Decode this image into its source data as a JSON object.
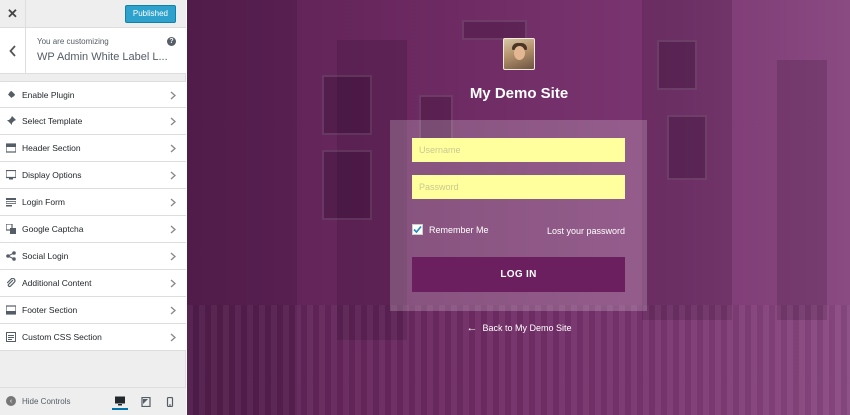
{
  "topbar": {
    "close_glyph": "✕",
    "publish_label": "Published"
  },
  "info": {
    "label": "You are customizing",
    "title": "WP Admin White Label L...",
    "help_glyph": "?"
  },
  "menu": {
    "items": [
      {
        "label": "Enable Plugin",
        "icon": "plugin-icon"
      },
      {
        "label": "Select Template",
        "icon": "pin-icon"
      },
      {
        "label": "Header Section",
        "icon": "header-icon"
      },
      {
        "label": "Display Options",
        "icon": "monitor-icon"
      },
      {
        "label": "Login Form",
        "icon": "form-icon"
      },
      {
        "label": "Google Captcha",
        "icon": "captcha-icon"
      },
      {
        "label": "Social Login",
        "icon": "share-icon"
      },
      {
        "label": "Additional Content",
        "icon": "paperclip-icon"
      },
      {
        "label": "Footer Section",
        "icon": "footer-icon"
      },
      {
        "label": "Custom CSS Section",
        "icon": "css-icon"
      }
    ]
  },
  "bottombar": {
    "hide_label": "Hide Controls",
    "devices": [
      "desktop-icon",
      "tablet-icon",
      "mobile-icon"
    ],
    "active_device": "desktop-icon"
  },
  "preview": {
    "site_title": "My Demo Site",
    "username_placeholder": "Username",
    "password_placeholder": "Password",
    "remember_label": "Remember Me",
    "remember_checked": true,
    "lost_password": "Lost your password",
    "login_button": "LOG IN",
    "back_arrow": "←",
    "back_link": "Back to My Demo Site"
  },
  "colors": {
    "publish": "#2ea2cc",
    "overlay": "#6e2b63",
    "field": "#ffff9e",
    "login_button": "#6b1f5f"
  }
}
